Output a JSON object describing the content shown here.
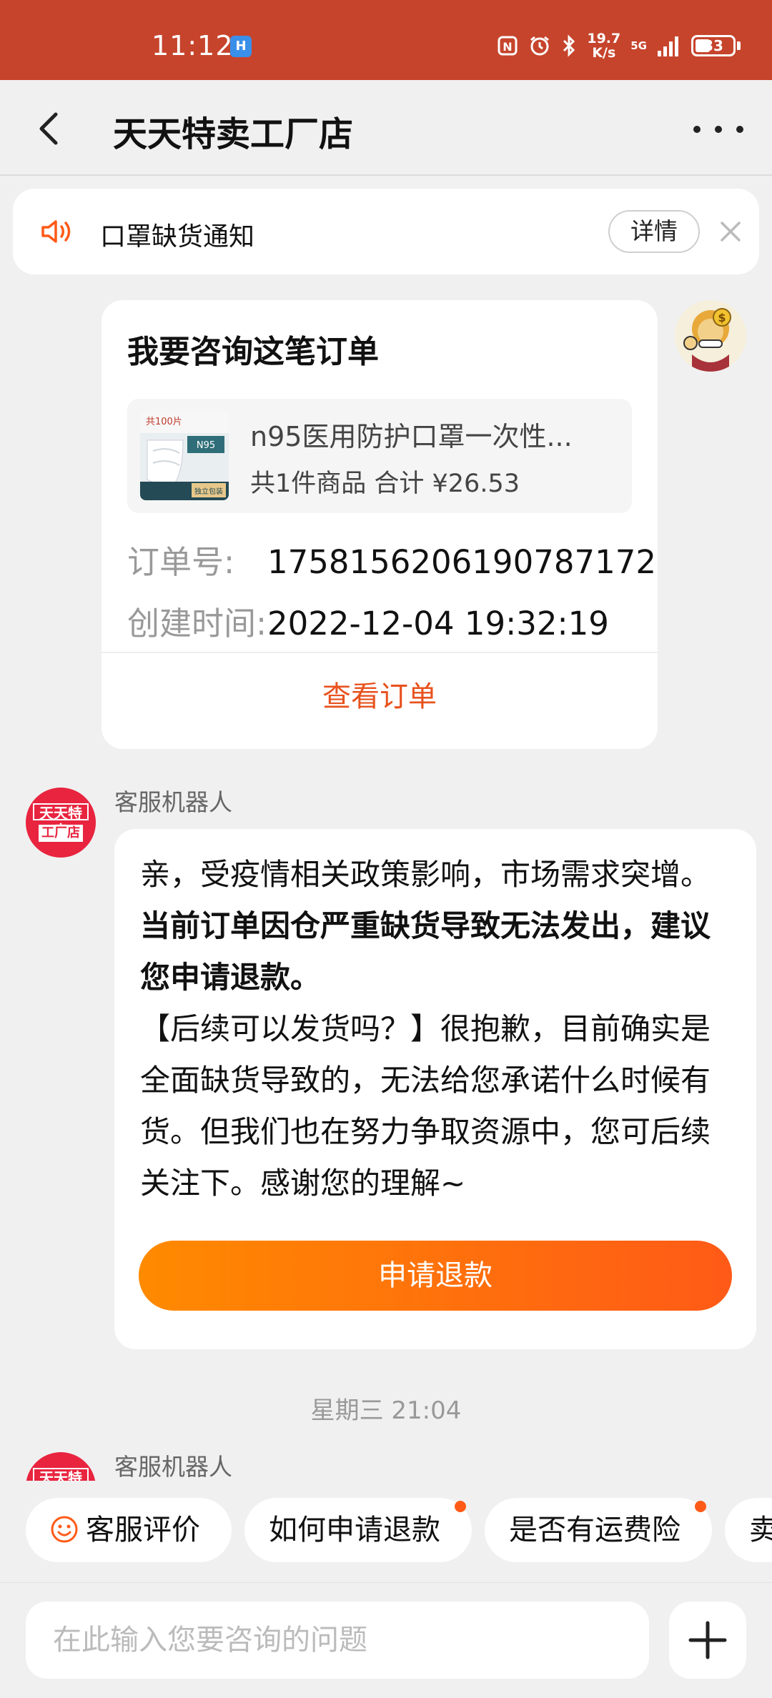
{
  "status_bar": {
    "time": "11:12",
    "speed_value": "19.7",
    "speed_unit": "K/s",
    "network": "5G",
    "battery": "33",
    "icons": [
      "nfc-icon",
      "alarm-icon",
      "bluetooth-icon",
      "signal-icon",
      "battery-icon"
    ]
  },
  "header": {
    "title": "天天特卖工厂店",
    "back_icon": "chevron-left-icon",
    "more_icon": "more-icon"
  },
  "notice": {
    "text": "口罩缺货通知",
    "detail_label": "详情",
    "icon": "speaker-icon"
  },
  "order_card": {
    "title": "我要咨询这笔订单",
    "product_name": "n95医用防护口罩一次性...",
    "product_summary": "共1件商品 合计 ¥26.53",
    "thumb_text_top": "共100片",
    "thumb_text_sub": "独立包装",
    "order_no_label": "订单号:",
    "order_no": "1758156206190787172",
    "created_label": "创建时间:",
    "created_time": "2022-12-04 19:32:19",
    "view_order_label": "查看订单"
  },
  "messages": {
    "bot_name": "客服机器人",
    "bot_avatar_line1": "天天特卖",
    "bot_avatar_line2": "工厂店",
    "text_part1": "亲，受疫情相关政策影响，市场需求突增。",
    "text_bold": "当前订单因仓严重缺货导致无法发出，建议您申请退款。",
    "text_part2": "【后续可以发货吗？】很抱歉，目前确实是全面缺货导致的，无法给您承诺什么时候有货。但我们也在努力争取资源中，您可后续关注下。感谢您的理解~",
    "refund_button": "申请退款",
    "time_separator": "星期三 21:04",
    "bot_name_2": "客服机器人"
  },
  "quick_chips": [
    {
      "label": "客服评价",
      "dot": false
    },
    {
      "label": "如何申请退款",
      "dot": true
    },
    {
      "label": "是否有运费险",
      "dot": true
    },
    {
      "label": "卖",
      "dot": false
    }
  ],
  "input": {
    "placeholder": "在此输入您要咨询的问题",
    "plus_icon": "plus-icon"
  },
  "colors": {
    "status_bar": "#c6442c",
    "accent": "#e8521e",
    "button_start": "#ff8a00",
    "button_end": "#ff5a17",
    "bot_avatar": "#e8243f"
  }
}
